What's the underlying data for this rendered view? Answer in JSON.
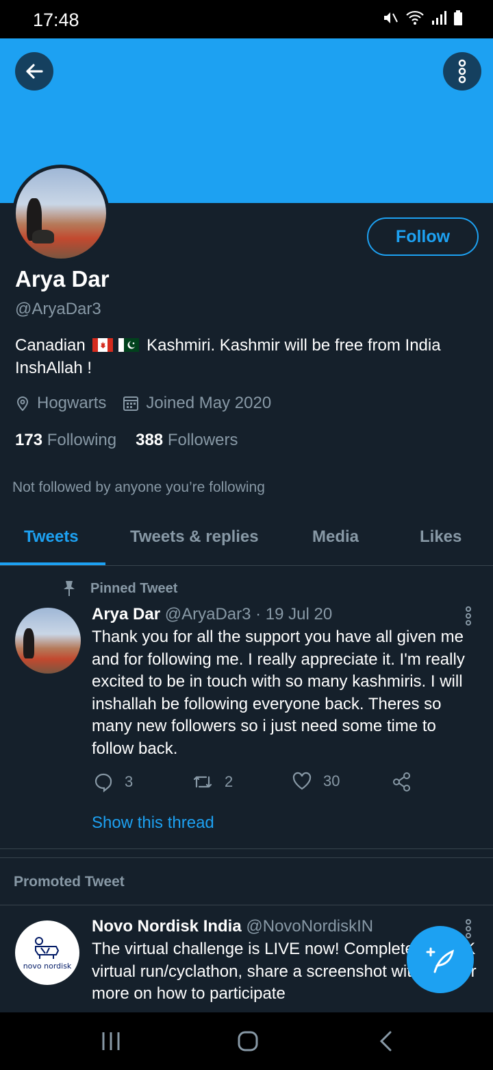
{
  "status_bar": {
    "time": "17:48"
  },
  "profile": {
    "name": "Arya Dar",
    "handle": "@AryaDar3",
    "bio_part1": "Canadian",
    "bio_part2": "Kashmiri.  Kashmir will be free from India InshAllah !",
    "location": "Hogwarts",
    "joined": "Joined May 2020",
    "following_count": "173",
    "following_label": "Following",
    "followers_count": "388",
    "followers_label": "Followers",
    "follow_button": "Follow",
    "not_followed_text": "Not followed by anyone you’re following"
  },
  "tabs": [
    {
      "label": "Tweets",
      "active": true
    },
    {
      "label": "Tweets & replies",
      "active": false
    },
    {
      "label": "Media",
      "active": false
    },
    {
      "label": "Likes",
      "active": false
    }
  ],
  "pinned_tweet": {
    "pinned_label": "Pinned Tweet",
    "author_name": "Arya Dar",
    "author_handle": "@AryaDar3",
    "date": "· 19 Jul 20",
    "text": "Thank you for all the support you have all given me and for following me. I really appreciate it. I'm really excited to be in touch with so many kashmiris. I will inshallah be following everyone back. Theres so many new followers so i just need some time to follow back.",
    "replies": "3",
    "retweets": "2",
    "likes": "30",
    "show_thread": "Show this thread"
  },
  "promoted": {
    "section_label": "Promoted Tweet",
    "author_name": "Novo Nordisk India",
    "author_handle": "@NovoNordiskIN",
    "avatar_text": "novo nordisk",
    "text": "The virtual challenge is LIVE now! Complete your 5K virtual run/cyclathon, share a screenshot with us. For more on how to participate"
  },
  "colors": {
    "accent": "#1da1f2",
    "background": "#15202b",
    "secondary_text": "#8899a6",
    "divider": "#38444d"
  }
}
